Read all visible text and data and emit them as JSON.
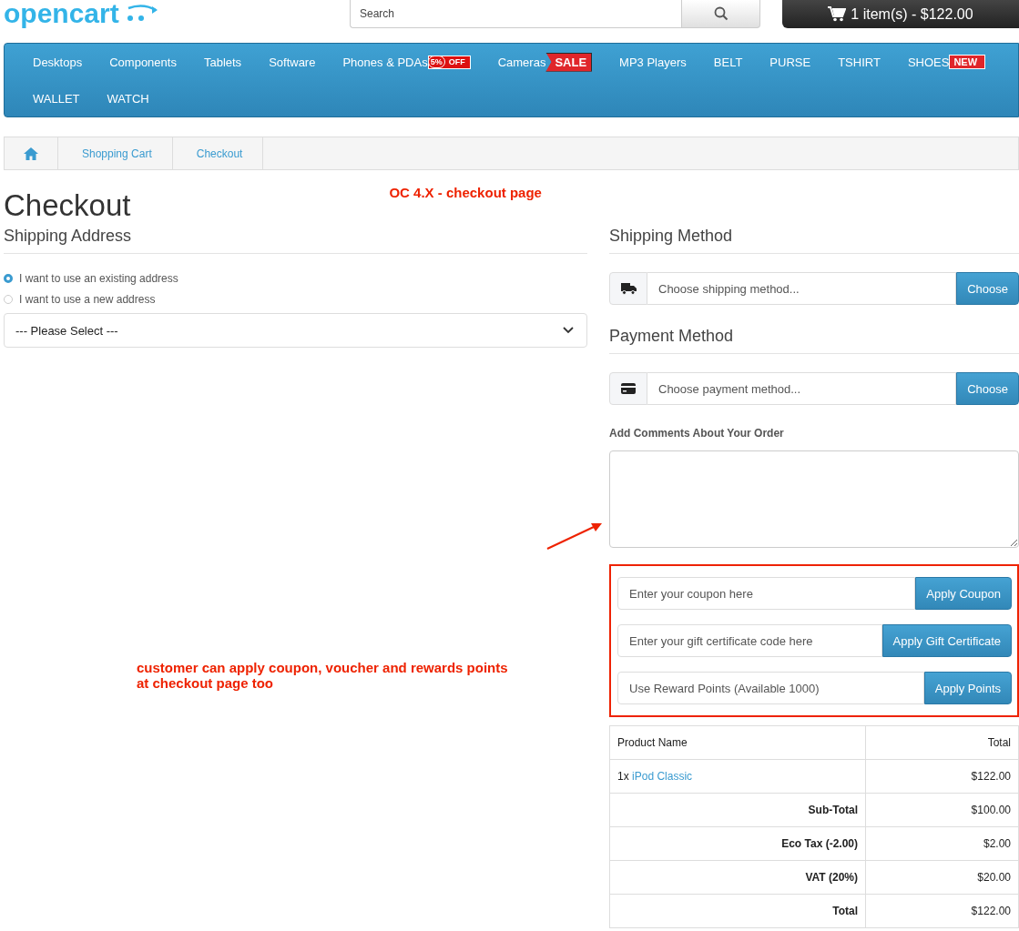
{
  "logo": {
    "text": "opencart"
  },
  "search": {
    "placeholder": "Search"
  },
  "cart": {
    "label": "1 item(s) - $122.00"
  },
  "menu": [
    {
      "label": "Desktops"
    },
    {
      "label": "Components"
    },
    {
      "label": "Tablets"
    },
    {
      "label": "Software"
    },
    {
      "label": "Phones & PDAs",
      "badge": {
        "kind": "discount",
        "text": "5%",
        "extra": "OFF"
      }
    },
    {
      "label": "Cameras",
      "badge": {
        "kind": "sale",
        "text": "SALE"
      }
    },
    {
      "label": "MP3 Players"
    },
    {
      "label": "BELT"
    },
    {
      "label": "PURSE"
    },
    {
      "label": "TSHIRT"
    },
    {
      "label": "SHOES",
      "badge": {
        "kind": "new",
        "text": "NEW"
      }
    },
    {
      "label": "WALLET"
    },
    {
      "label": "WATCH"
    }
  ],
  "breadcrumb": [
    "Shopping Cart",
    "Checkout"
  ],
  "title": "Checkout",
  "note_top": "OC 4.X - checkout page",
  "shipping_address": {
    "heading": "Shipping Address",
    "options": [
      {
        "label": "I want to use an existing address",
        "selected": true
      },
      {
        "label": "I want to use a new address",
        "selected": false
      }
    ],
    "select": "--- Please Select ---"
  },
  "note_side": {
    "lines": [
      "customer can apply coupon, voucher and rewards points",
      "at checkout page too"
    ]
  },
  "shipping_method": {
    "heading": "Shipping Method",
    "placeholder": "Choose shipping method...",
    "button": "Choose"
  },
  "payment_method": {
    "heading": "Payment Method",
    "placeholder": "Choose payment method...",
    "button": "Choose"
  },
  "comments": {
    "label": "Add Comments About Your Order"
  },
  "discounts": [
    {
      "placeholder": "Enter your coupon here",
      "button": "Apply Coupon"
    },
    {
      "placeholder": "Enter your gift certificate code here",
      "button": "Apply Gift Certificate"
    },
    {
      "placeholder": "Use Reward Points (Available 1000)",
      "button": "Apply Points"
    }
  ],
  "table": {
    "columns": [
      "Product Name",
      "Total"
    ],
    "products": [
      {
        "quantity": "1x",
        "name": "iPod Classic",
        "total": "$122.00"
      }
    ],
    "totals": [
      {
        "label": "Sub-Total",
        "value": "$100.00"
      },
      {
        "label": "Eco Tax (-2.00)",
        "value": "$2.00"
      },
      {
        "label": "VAT (20%)",
        "value": "$20.00"
      },
      {
        "label": "Total",
        "value": "$122.00"
      }
    ]
  }
}
